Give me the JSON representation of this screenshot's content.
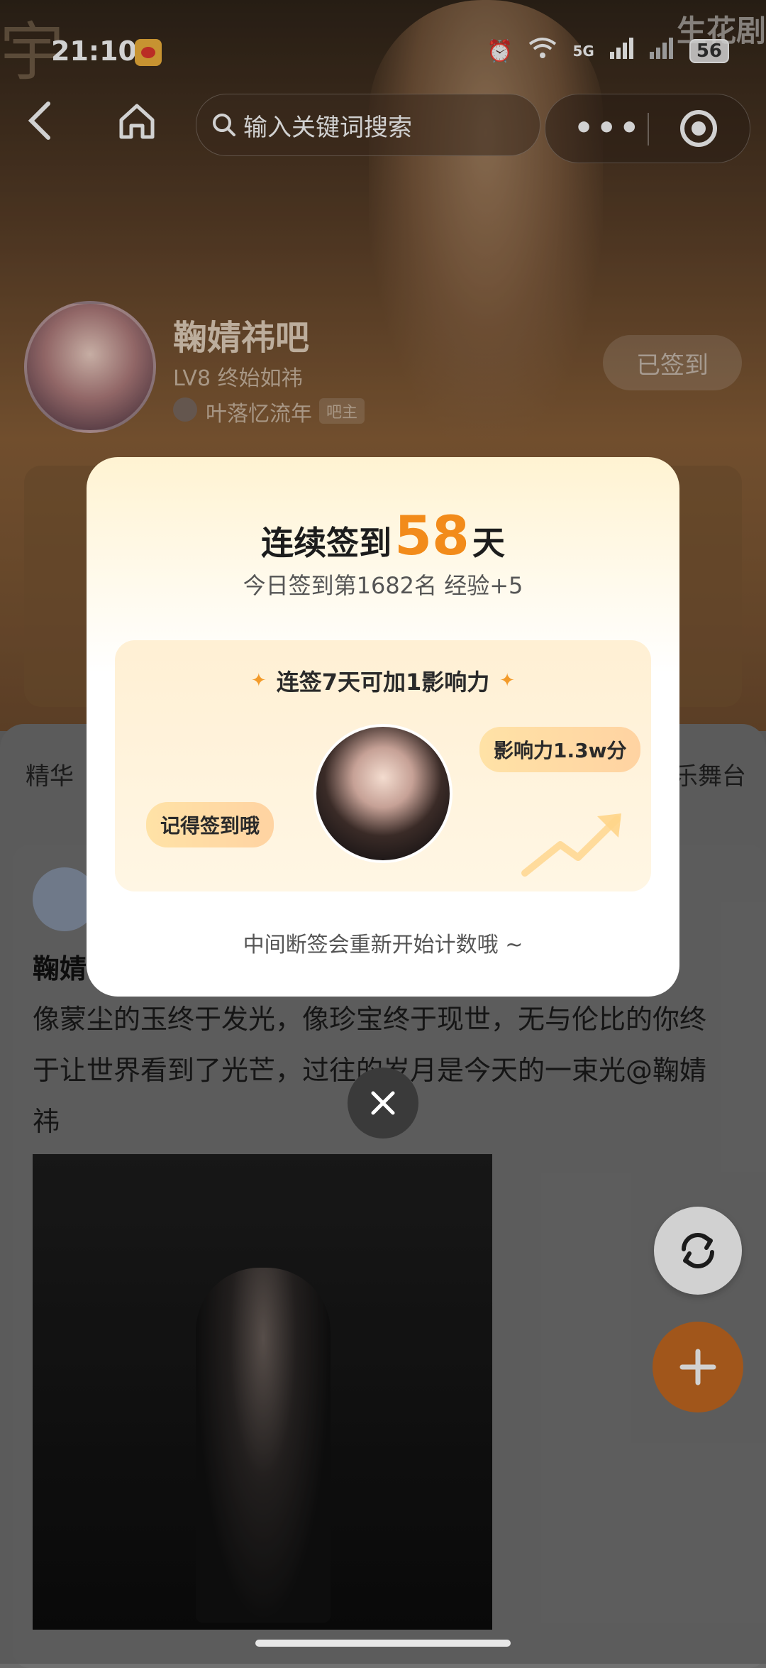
{
  "status_bar": {
    "time": "21:10",
    "network": "5G",
    "battery": "56",
    "watermark": "生花剧"
  },
  "nav": {
    "search_placeholder": "输入关键词搜索",
    "capsule_dots": "•••"
  },
  "bar_header": {
    "name": "鞠婧祎吧",
    "level": "LV8 终始如祎",
    "owner": "叶落忆流年",
    "owner_badge": "吧主",
    "signed_label": "已签到"
  },
  "tabs": {
    "left": "精华",
    "right": "乐舞台"
  },
  "post": {
    "author": "鞠婧",
    "text": "像蒙尘的玉终于发光，像珍宝终于现世，无与伦比的你终于让世界看到了光芒，过往的岁月是今天的一束光@鞠婧祎"
  },
  "modal": {
    "headline_prefix": "连续签到",
    "days": "58",
    "headline_suffix": "天",
    "rank_line": "今日签到第1682名 经验+5",
    "inner_title": "连签7天可加1影响力",
    "bubble_left": "记得签到哦",
    "bubble_right": "影响力1.3w分",
    "footnote": "中间断签会重新开始计数哦 ~"
  },
  "colors": {
    "accent_orange": "#f28b1a",
    "add_button": "#c56a22"
  },
  "icons": [
    "back-icon",
    "home-icon",
    "search-icon",
    "more-dots-icon",
    "target-icon",
    "close-icon",
    "refresh-icon",
    "plus-icon"
  ]
}
